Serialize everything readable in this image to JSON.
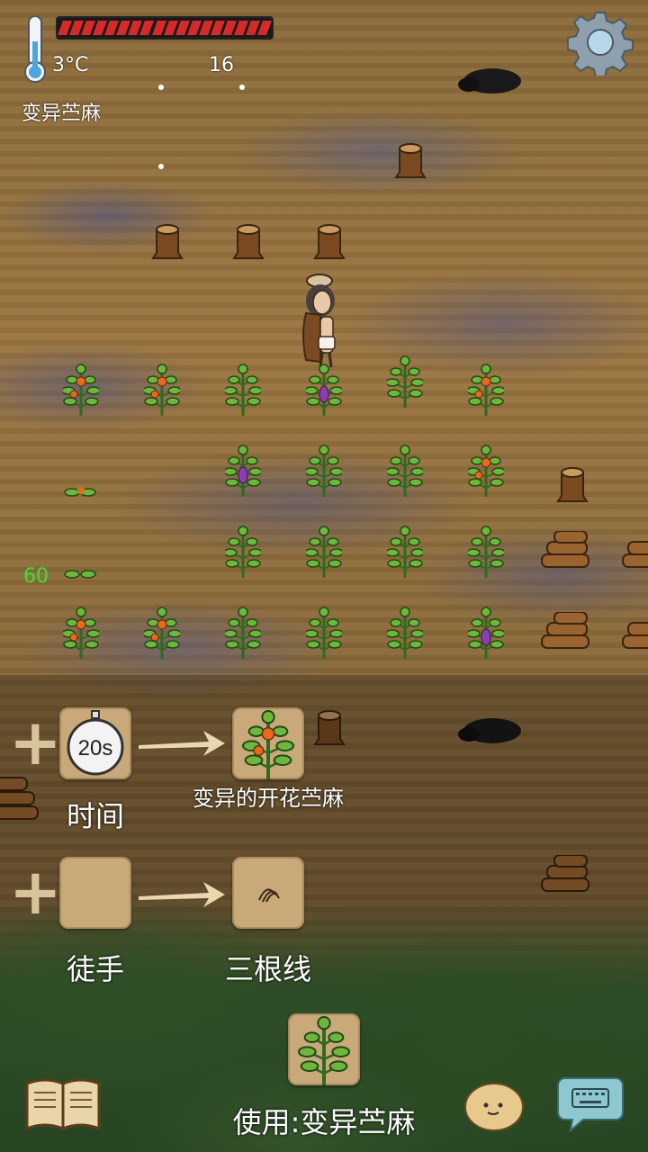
{
  "hud": {
    "temperature": "3°C",
    "age": "16",
    "held_item": "变异苎麻",
    "food_pips_filled": 18,
    "food_pips_total": 18,
    "status_number": "60"
  },
  "recipes": [
    {
      "tool_label": "时间",
      "tool_timer": "20s",
      "result_label": "变异的开花苎麻"
    },
    {
      "tool_label": "徒手",
      "result_label": "三根线"
    }
  ],
  "bottom": {
    "use_label": "使用:变异苎麻"
  },
  "colors": {
    "food": "#d62a2a",
    "tile": "#c9a879",
    "status_green": "#33e333"
  },
  "icons": [
    "thermometer-icon",
    "settings-gear-icon",
    "stopwatch-icon",
    "recipe-book-icon",
    "emote-potato-icon",
    "keyboard-chat-icon"
  ]
}
